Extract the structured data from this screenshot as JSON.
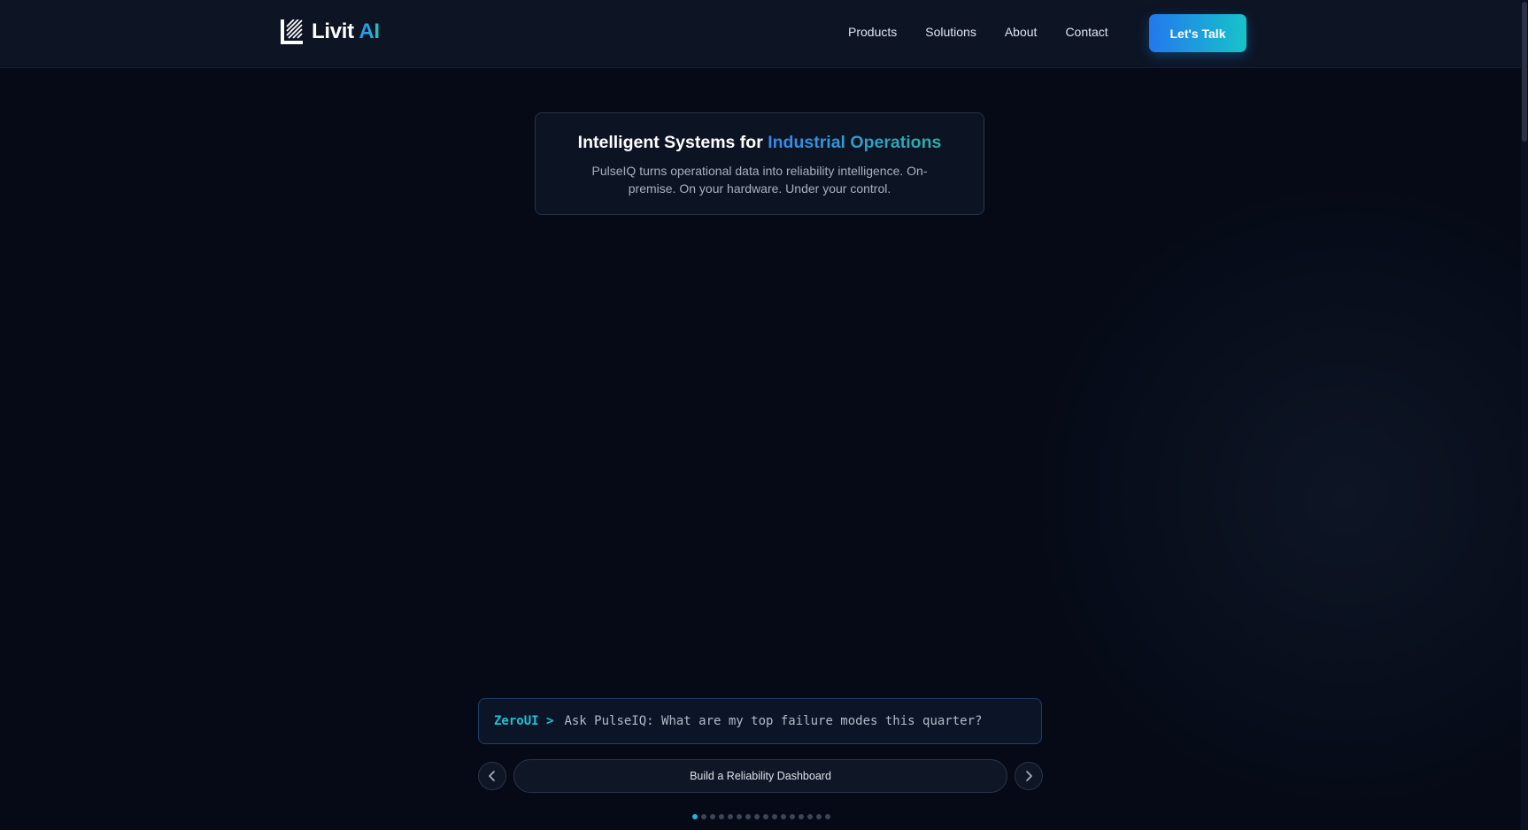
{
  "header": {
    "logo": {
      "name": "Livit",
      "accent": "AI"
    },
    "nav": [
      {
        "label": "Products"
      },
      {
        "label": "Solutions"
      },
      {
        "label": "About"
      },
      {
        "label": "Contact"
      }
    ],
    "cta_label": "Let's Talk"
  },
  "hero": {
    "title_prefix": "Intelligent Systems for",
    "title_highlight": "Industrial Operations",
    "subtitle": "PulseIQ turns operational data into reliability intelligence. On-premise. On your hardware. Under your control."
  },
  "prompt": {
    "label": "ZeroUI >",
    "text": "Ask PulseIQ: What are my top failure modes this quarter?"
  },
  "carousel": {
    "prev_icon": "chevron-left-icon",
    "next_icon": "chevron-right-icon",
    "current_label": "Build a Reliability Dashboard",
    "active_index": 0,
    "total": 16
  },
  "colors": {
    "background": "#050a16",
    "header": "#0d1424",
    "accent_blue": "#2378ee",
    "accent_teal": "#17c3c9",
    "prompt_label": "#1ec3d6"
  }
}
